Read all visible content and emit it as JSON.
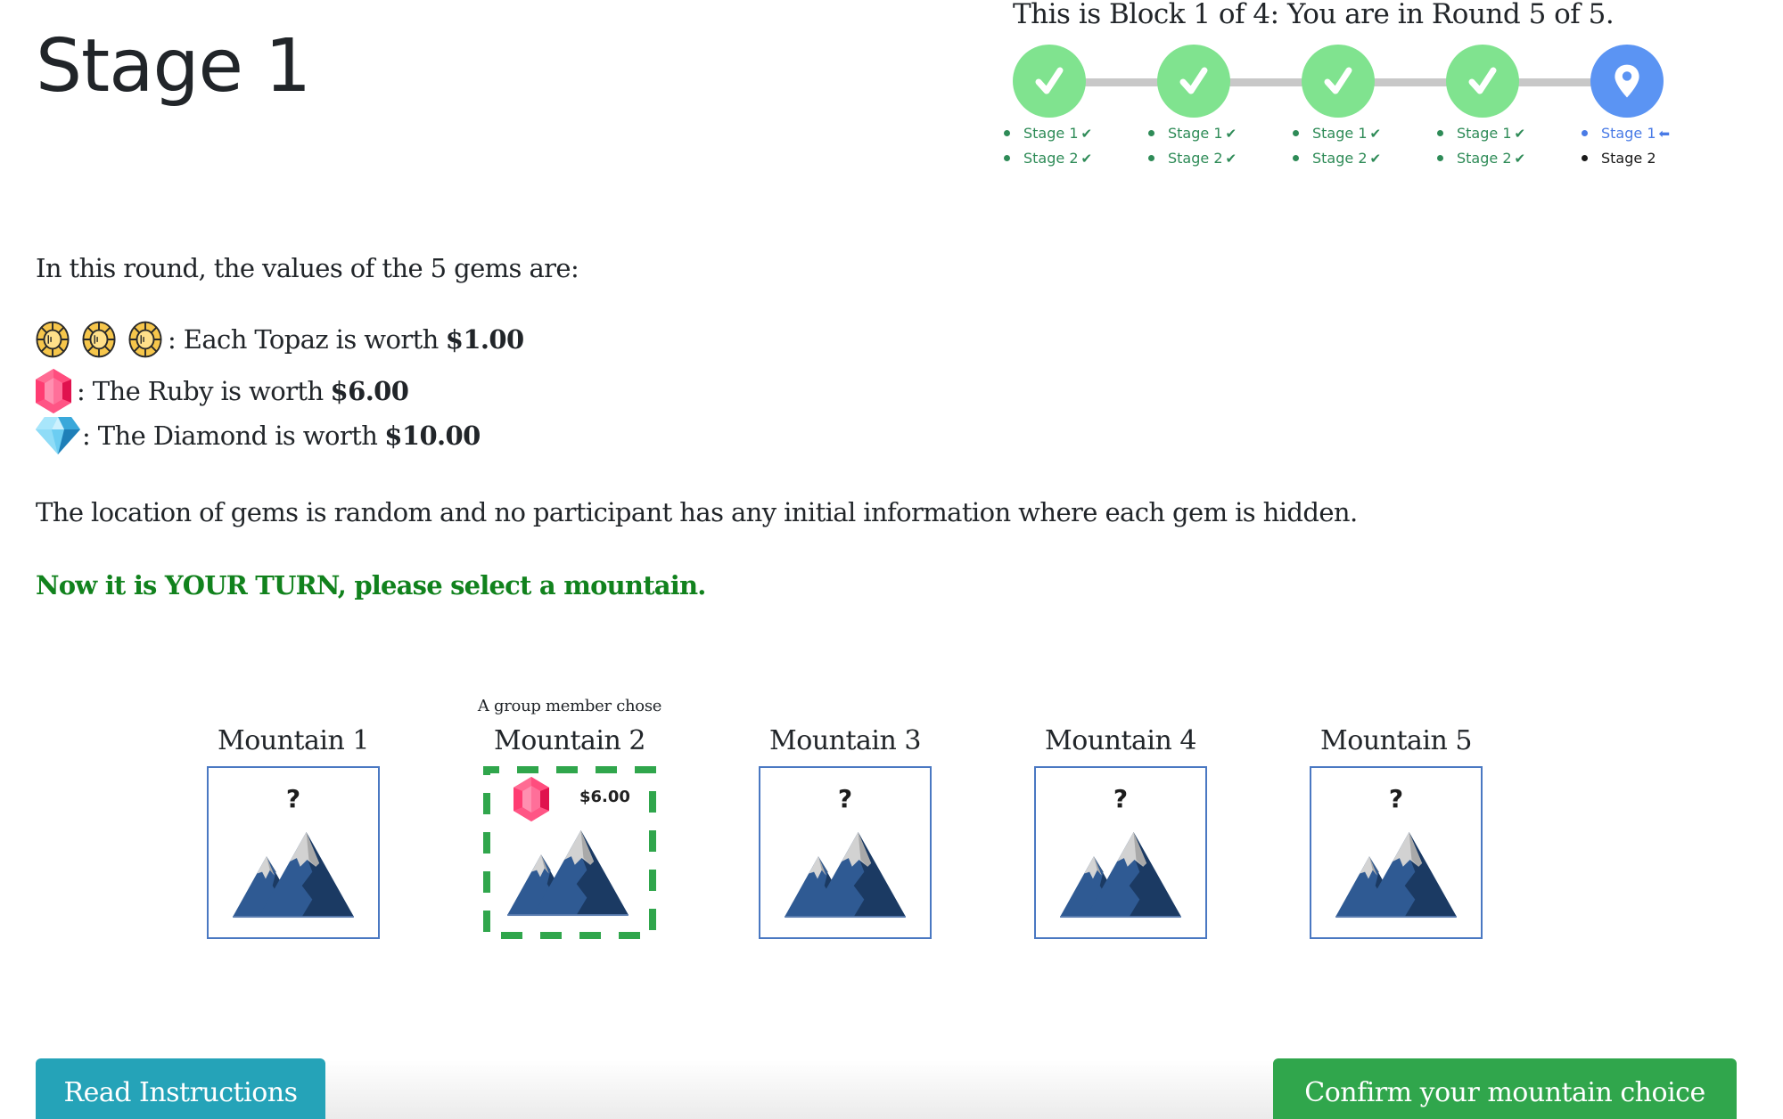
{
  "page": {
    "title": "Stage 1"
  },
  "progress": {
    "title": "This is Block 1 of 4: You are in Round 5 of 5.",
    "block": 1,
    "blocks_total": 4,
    "round": 5,
    "rounds_total": 5,
    "rounds": [
      {
        "status": "completed",
        "icon": "check-icon",
        "stages": [
          {
            "label": "Stage 1",
            "mark": "✔",
            "status": "done"
          },
          {
            "label": "Stage 2",
            "mark": "✔",
            "status": "done"
          }
        ]
      },
      {
        "status": "completed",
        "icon": "check-icon",
        "stages": [
          {
            "label": "Stage 1",
            "mark": "✔",
            "status": "done"
          },
          {
            "label": "Stage 2",
            "mark": "✔",
            "status": "done"
          }
        ]
      },
      {
        "status": "completed",
        "icon": "check-icon",
        "stages": [
          {
            "label": "Stage 1",
            "mark": "✔",
            "status": "done"
          },
          {
            "label": "Stage 2",
            "mark": "✔",
            "status": "done"
          }
        ]
      },
      {
        "status": "completed",
        "icon": "check-icon",
        "stages": [
          {
            "label": "Stage 1",
            "mark": "✔",
            "status": "done"
          },
          {
            "label": "Stage 2",
            "mark": "✔",
            "status": "done"
          }
        ]
      },
      {
        "status": "current",
        "icon": "map-pin-icon",
        "stages": [
          {
            "label": "Stage 1",
            "mark": "⬅",
            "status": "current"
          },
          {
            "label": "Stage 2",
            "mark": "",
            "status": "pending"
          }
        ]
      }
    ],
    "colors": {
      "completed": "#80e38f",
      "current": "#5b94f3",
      "done_text": "#2e8b57",
      "current_text": "#4a7be6"
    }
  },
  "gems": {
    "intro": "In this round, the values of the 5 gems are:",
    "topaz": {
      "icon": "topaz-icon",
      "count": 3,
      "text": ": Each Topaz is worth",
      "value": "$1.00"
    },
    "ruby": {
      "icon": "ruby-icon",
      "text": ": The Ruby is worth",
      "value": "$6.00"
    },
    "diamond": {
      "icon": "diamond-icon",
      "text": ": The Diamond is worth",
      "value": "$10.00"
    }
  },
  "info_text": "The location of gems is random and no participant has any initial information where each gem is hidden.",
  "turn_text": "Now it is YOUR TURN, please select a mountain.",
  "mountains": [
    {
      "label": "Mountain 1",
      "note": "",
      "revealed": false,
      "placeholder": "?"
    },
    {
      "label": "Mountain 2",
      "note": "A group member chose",
      "revealed": true,
      "gem": "ruby-icon",
      "value": "$6.00"
    },
    {
      "label": "Mountain 3",
      "note": "",
      "revealed": false,
      "placeholder": "?"
    },
    {
      "label": "Mountain 4",
      "note": "",
      "revealed": false,
      "placeholder": "?"
    },
    {
      "label": "Mountain 5",
      "note": "",
      "revealed": false,
      "placeholder": "?"
    }
  ],
  "buttons": {
    "instructions": "Read Instructions",
    "confirm": "Confirm your mountain choice"
  },
  "colors": {
    "turn_text": "#11821d",
    "mountain_border": "#4a78c2",
    "chosen_border": "#30a64c",
    "instructions_button": "#25a3b8",
    "confirm_button": "#30a64c"
  }
}
